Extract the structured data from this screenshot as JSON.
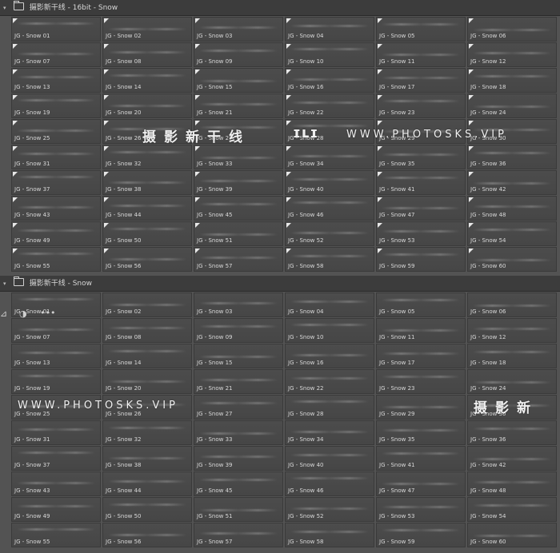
{
  "groups": [
    {
      "title": "摄影新干线 - 16bit - Snow"
    },
    {
      "title": "摄影新干线 - Snow"
    }
  ],
  "brushes": [
    "JG - Snow 01",
    "JG - Snow 02",
    "JG - Snow 03",
    "JG - Snow 04",
    "JG - Snow 05",
    "JG - Snow 06",
    "JG - Snow 07",
    "JG - Snow 08",
    "JG - Snow 09",
    "JG - Snow 10",
    "JG - Snow 11",
    "JG - Snow 12",
    "JG - Snow 13",
    "JG - Snow 14",
    "JG - Snow 15",
    "JG - Snow 16",
    "JG - Snow 17",
    "JG - Snow 18",
    "JG - Snow 19",
    "JG - Snow 20",
    "JG - Snow 21",
    "JG - Snow 22",
    "JG - Snow 23",
    "JG - Snow 24",
    "JG - Snow 25",
    "JG - Snow 26",
    "JG - Snow 27",
    "JG - Snow 28",
    "JG - Snow 29",
    "JG - Snow 30",
    "JG - Snow 31",
    "JG - Snow 32",
    "JG - Snow 33",
    "JG - Snow 34",
    "JG - Snow 35",
    "JG - Snow 36",
    "JG - Snow 37",
    "JG - Snow 38",
    "JG - Snow 39",
    "JG - Snow 40",
    "JG - Snow 41",
    "JG - Snow 42",
    "JG - Snow 43",
    "JG - Snow 44",
    "JG - Snow 45",
    "JG - Snow 46",
    "JG - Snow 47",
    "JG - Snow 48",
    "JG - Snow 49",
    "JG - Snow 50",
    "JG - Snow 51",
    "JG - Snow 52",
    "JG - Snow 53",
    "JG - Snow 54",
    "JG - Snow 55",
    "JG - Snow 56",
    "JG - Snow 57",
    "JG - Snow 58",
    "JG - Snow 59",
    "JG - Snow 60"
  ],
  "watermarks": {
    "cn": "摄影新干线",
    "en": "WWW.PHOTOSKS.VIP",
    "cn_partial": "摄影新"
  },
  "icons": [
    "folder-icon",
    "chevron-down-icon",
    "transform-icon",
    "contrast-icon",
    "more-icon",
    "corner-marker-icon"
  ],
  "colors": {
    "panel": "#535353",
    "tile": "#4a4a4a",
    "header": "#3c3c3c",
    "text": "#d8d8d8"
  }
}
